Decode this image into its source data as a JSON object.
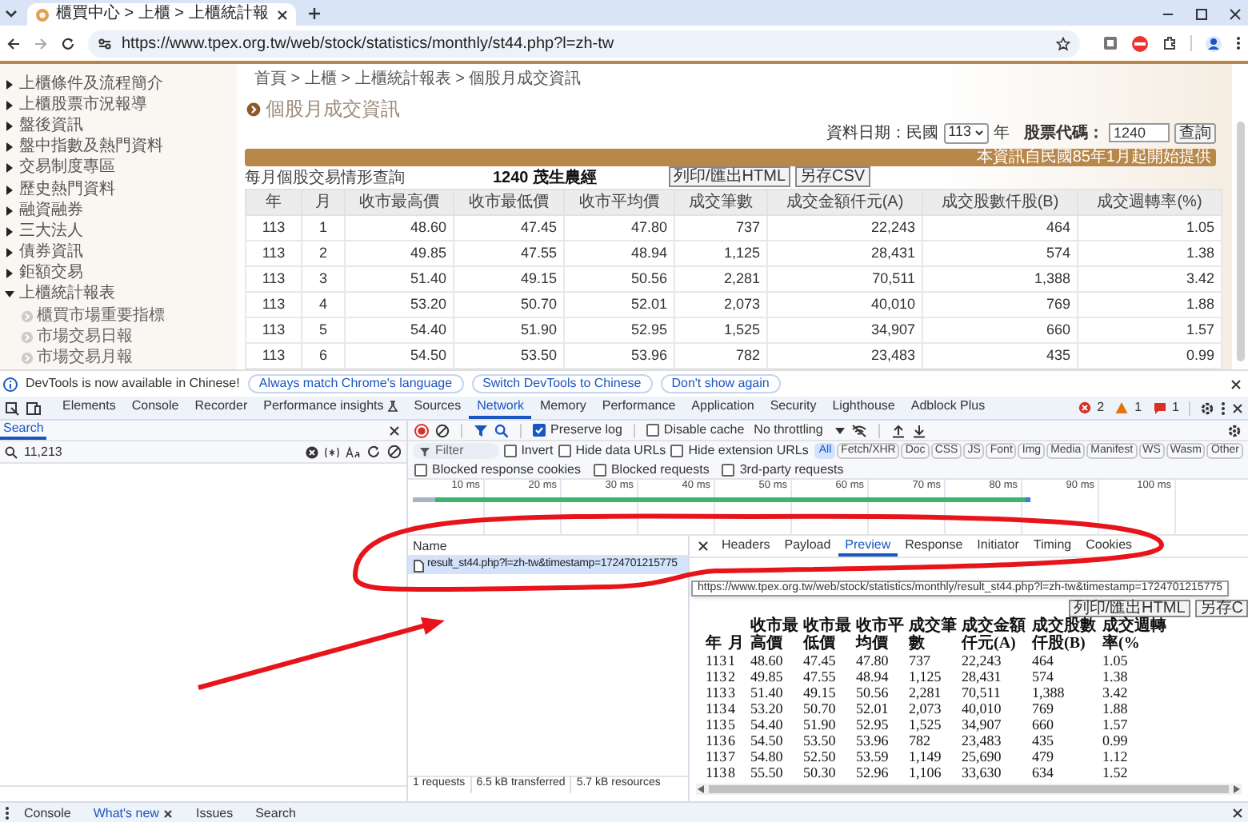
{
  "browser": {
    "tab_title": "櫃買中心 > 上櫃 > 上櫃統計報",
    "url": "https://www.tpex.org.tw/web/stock/statistics/monthly/st44.php?l=zh-tw"
  },
  "sidebar": {
    "items": [
      {
        "label": "上櫃條件及流程簡介",
        "expanded": false
      },
      {
        "label": "上櫃股票市況報導",
        "expanded": false
      },
      {
        "label": "盤後資訊",
        "expanded": false
      },
      {
        "label": "盤中指數及熱門資料",
        "expanded": false
      },
      {
        "label": "交易制度專區",
        "expanded": false
      },
      {
        "label": "歷史熱門資料",
        "expanded": false
      },
      {
        "label": "融資融券",
        "expanded": false
      },
      {
        "label": "三大法人",
        "expanded": false
      },
      {
        "label": "債券資訊",
        "expanded": false
      },
      {
        "label": "鉅額交易",
        "expanded": false
      },
      {
        "label": "上櫃統計報表",
        "expanded": true,
        "children": [
          {
            "label": "櫃買市場重要指標"
          },
          {
            "label": "市場交易日報"
          },
          {
            "label": "市場交易月報"
          }
        ]
      }
    ]
  },
  "page": {
    "breadcrumb": "首頁 > 上櫃 > 上櫃統計報表 > 個股月成交資訊",
    "title": "個股月成交資訊",
    "form": {
      "date_label": "資料日期：民國",
      "year": "113",
      "year_unit": "年",
      "code_label": "股票代碼：",
      "code": "1240",
      "query_button": "查詢"
    },
    "notice": "本資訊自民國85年1月起開始提供",
    "caption": "每月個股交易情形查詢",
    "stock": "1240 茂生農經",
    "buttons": [
      "列印/匯出HTML",
      "另存CSV"
    ],
    "table": {
      "columns": [
        "年",
        "月",
        "收市最高價",
        "收市最低價",
        "收市平均價",
        "成交筆數",
        "成交金額仟元(A)",
        "成交股數仟股(B)",
        "成交週轉率(%)"
      ],
      "rows": [
        [
          "113",
          "1",
          "48.60",
          "47.45",
          "47.80",
          "737",
          "22,243",
          "464",
          "1.05"
        ],
        [
          "113",
          "2",
          "49.85",
          "47.55",
          "48.94",
          "1,125",
          "28,431",
          "574",
          "1.38"
        ],
        [
          "113",
          "3",
          "51.40",
          "49.15",
          "50.56",
          "2,281",
          "70,511",
          "1,388",
          "3.42"
        ],
        [
          "113",
          "4",
          "53.20",
          "50.70",
          "52.01",
          "2,073",
          "40,010",
          "769",
          "1.88"
        ],
        [
          "113",
          "5",
          "54.40",
          "51.90",
          "52.95",
          "1,525",
          "34,907",
          "660",
          "1.57"
        ],
        [
          "113",
          "6",
          "54.50",
          "53.50",
          "53.96",
          "782",
          "23,483",
          "435",
          "0.99"
        ]
      ]
    }
  },
  "devtools": {
    "notice": {
      "text": "DevTools is now available in Chinese!",
      "buttons": [
        "Always match Chrome's language",
        "Switch DevTools to Chinese",
        "Don't show again"
      ]
    },
    "tabs": [
      {
        "label": "Elements",
        "selected": false
      },
      {
        "label": "Console",
        "selected": false
      },
      {
        "label": "Recorder",
        "selected": false
      },
      {
        "label": "Performance insights",
        "selected": false,
        "has_icon": true
      },
      {
        "label": "Sources",
        "selected": false
      },
      {
        "label": "Network",
        "selected": true
      },
      {
        "label": "Memory",
        "selected": false
      },
      {
        "label": "Performance",
        "selected": false
      },
      {
        "label": "Application",
        "selected": false
      },
      {
        "label": "Security",
        "selected": false
      },
      {
        "label": "Lighthouse",
        "selected": false
      },
      {
        "label": "Adblock Plus",
        "selected": false
      }
    ],
    "counts": {
      "errors": "2",
      "warnings": "1",
      "issues": "1"
    },
    "search": {
      "title": "Search",
      "query": "11,213"
    },
    "network": {
      "preserve_log": {
        "label": "Preserve log",
        "checked": true
      },
      "disable_cache": {
        "label": "Disable cache",
        "checked": false
      },
      "throttling": "No throttling",
      "filter_placeholder": "Filter",
      "filter_checks": [
        {
          "label": "Invert",
          "checked": false
        },
        {
          "label": "Hide data URLs",
          "checked": false
        },
        {
          "label": "Hide extension URLs",
          "checked": false
        }
      ],
      "types": [
        {
          "label": "All",
          "selected": true
        },
        {
          "label": "Fetch/XHR",
          "selected": false
        },
        {
          "label": "Doc",
          "selected": false
        },
        {
          "label": "CSS",
          "selected": false
        },
        {
          "label": "JS",
          "selected": false
        },
        {
          "label": "Font",
          "selected": false
        },
        {
          "label": "Img",
          "selected": false
        },
        {
          "label": "Media",
          "selected": false
        },
        {
          "label": "Manifest",
          "selected": false
        },
        {
          "label": "WS",
          "selected": false
        },
        {
          "label": "Wasm",
          "selected": false
        },
        {
          "label": "Other",
          "selected": false
        }
      ],
      "block_checks": [
        {
          "label": "Blocked response cookies",
          "checked": false
        },
        {
          "label": "Blocked requests",
          "checked": false
        },
        {
          "label": "3rd-party requests",
          "checked": false
        }
      ],
      "timeline_ticks": [
        "10 ms",
        "20 ms",
        "30 ms",
        "40 ms",
        "50 ms",
        "60 ms",
        "70 ms",
        "80 ms",
        "90 ms",
        "100 ms"
      ],
      "name_header": "Name",
      "requests": [
        {
          "name": "result_st44.php?l=zh-tw&timestamp=1724701215775",
          "selected": true
        }
      ],
      "detail_tabs": [
        {
          "label": "Headers",
          "selected": false
        },
        {
          "label": "Payload",
          "selected": false
        },
        {
          "label": "Preview",
          "selected": true
        },
        {
          "label": "Response",
          "selected": false
        },
        {
          "label": "Initiator",
          "selected": false
        },
        {
          "label": "Timing",
          "selected": false
        },
        {
          "label": "Cookies",
          "selected": false
        }
      ],
      "tooltip": "https://www.tpex.org.tw/web/stock/statistics/monthly/result_st44.php?l=zh-tw&timestamp=1724701215775",
      "preview": {
        "buttons": [
          "列印/匯出HTML",
          "另存C"
        ],
        "columns": [
          "年",
          "月",
          "收市最高價",
          "收市最低價",
          "收市平均價",
          "成交筆數",
          "成交金額仟元(A)",
          "成交股數仟股(B)",
          "成交週轉率(%"
        ],
        "rows": [
          [
            "113",
            "1",
            "48.60",
            "47.45",
            "47.80",
            "737",
            "22,243",
            "464",
            "1.05"
          ],
          [
            "113",
            "2",
            "49.85",
            "47.55",
            "48.94",
            "1,125",
            "28,431",
            "574",
            "1.38"
          ],
          [
            "113",
            "3",
            "51.40",
            "49.15",
            "50.56",
            "2,281",
            "70,511",
            "1,388",
            "3.42"
          ],
          [
            "113",
            "4",
            "53.20",
            "50.70",
            "52.01",
            "2,073",
            "40,010",
            "769",
            "1.88"
          ],
          [
            "113",
            "5",
            "54.40",
            "51.90",
            "52.95",
            "1,525",
            "34,907",
            "660",
            "1.57"
          ],
          [
            "113",
            "6",
            "54.50",
            "53.50",
            "53.96",
            "782",
            "23,483",
            "435",
            "0.99"
          ],
          [
            "113",
            "7",
            "54.80",
            "52.50",
            "53.59",
            "1,149",
            "25,690",
            "479",
            "1.12"
          ],
          [
            "113",
            "8",
            "55.50",
            "50.30",
            "52.96",
            "1,106",
            "33,630",
            "634",
            "1.52"
          ]
        ]
      },
      "status": [
        "1 requests",
        "6.5 kB transferred",
        "5.7 kB resources"
      ]
    },
    "drawer": {
      "tabs": [
        {
          "label": "Console",
          "selected": false
        },
        {
          "label": "What's new",
          "selected": true
        },
        {
          "label": "Issues",
          "selected": false
        },
        {
          "label": "Search",
          "selected": false
        }
      ]
    }
  }
}
